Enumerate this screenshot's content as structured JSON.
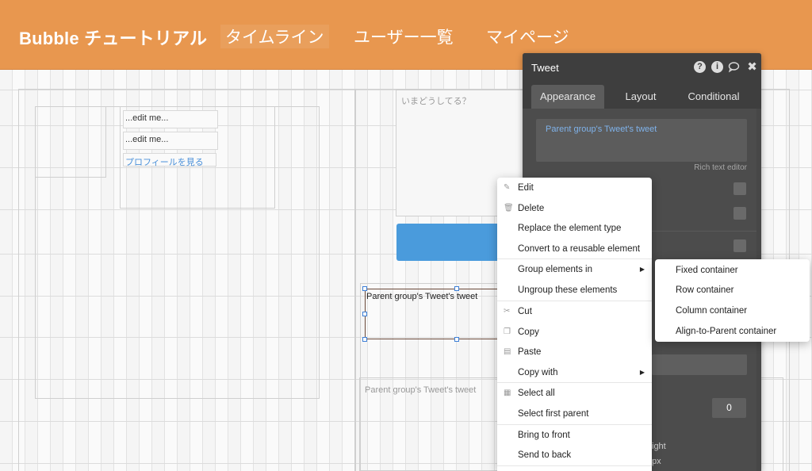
{
  "header": {
    "brand": "Bubble チュートリアル",
    "nav": [
      "タイムライン",
      "ユーザー一覧",
      "マイページ"
    ],
    "background_color": "#e8974f"
  },
  "canvas": {
    "profile_fields": [
      "...edit me...",
      "...edit me..."
    ],
    "profile_link": "プロフィールを見る",
    "tweet_placeholder": "いまどうしてる？",
    "selected_text": "Parent group's Tweet's tweet",
    "repeating_group_text": "Parent group's Tweet's tweet",
    "button_color": "#4a9bdc"
  },
  "editor": {
    "title": "Tweet",
    "icons": [
      "help-icon",
      "info-icon",
      "comment-icon",
      "close-icon"
    ],
    "tabs": [
      "Appearance",
      "Layout",
      "Conditional"
    ],
    "active_tab": "Appearance",
    "rich_text_value": "Parent group's Tweet's tweet",
    "rich_text_label": "Rich text editor",
    "number_value": "0",
    "partial_label_1": "ight",
    "partial_label_2": "px"
  },
  "context_menu": {
    "items": [
      {
        "label": "Edit",
        "icon": "pencil-icon"
      },
      {
        "label": "Delete",
        "icon": "trash-icon"
      },
      {
        "label": "Replace the element type",
        "icon": ""
      },
      {
        "label": "Convert to a reusable element",
        "icon": ""
      },
      {
        "label": "Group elements in",
        "icon": "",
        "submenu": true
      },
      {
        "label": "Ungroup these elements",
        "icon": ""
      },
      {
        "label": "Cut",
        "icon": "scissors-icon"
      },
      {
        "label": "Copy",
        "icon": "copy-icon"
      },
      {
        "label": "Paste",
        "icon": "paste-icon"
      },
      {
        "label": "Copy with",
        "icon": "",
        "submenu": true
      },
      {
        "label": "Select all",
        "icon": "grid-icon"
      },
      {
        "label": "Select first parent",
        "icon": ""
      },
      {
        "label": "Bring to front",
        "icon": ""
      },
      {
        "label": "Send to back",
        "icon": ""
      }
    ],
    "submenu_items": [
      "Fixed container",
      "Row container",
      "Column container",
      "Align-to-Parent container"
    ]
  }
}
